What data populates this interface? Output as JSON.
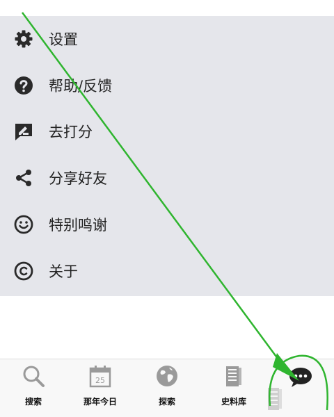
{
  "menu": {
    "items": [
      {
        "label": "设置",
        "icon": "gear-icon"
      },
      {
        "label": "帮助/反馈",
        "icon": "question-icon"
      },
      {
        "label": "去打分",
        "icon": "rate-icon"
      },
      {
        "label": "分享好友",
        "icon": "share-icon"
      },
      {
        "label": "特别鸣谢",
        "icon": "smile-icon"
      },
      {
        "label": "关于",
        "icon": "copyright-icon"
      }
    ]
  },
  "tabbar": {
    "tabs": [
      {
        "label": "搜索",
        "icon": "search-icon"
      },
      {
        "label": "那年今日",
        "icon": "calendar-icon"
      },
      {
        "label": "探索",
        "icon": "globe-icon"
      },
      {
        "label": "史料库",
        "icon": "archive-icon"
      },
      {
        "label": "",
        "icon": "chat-bubble-icon"
      }
    ],
    "calendar_day": "25"
  },
  "colors": {
    "menu_background": "#e5e6eb",
    "icon_dark": "#2a2a2a",
    "tab_icon_gray": "#9a9a9a",
    "annotation_green": "#2fb52f"
  }
}
